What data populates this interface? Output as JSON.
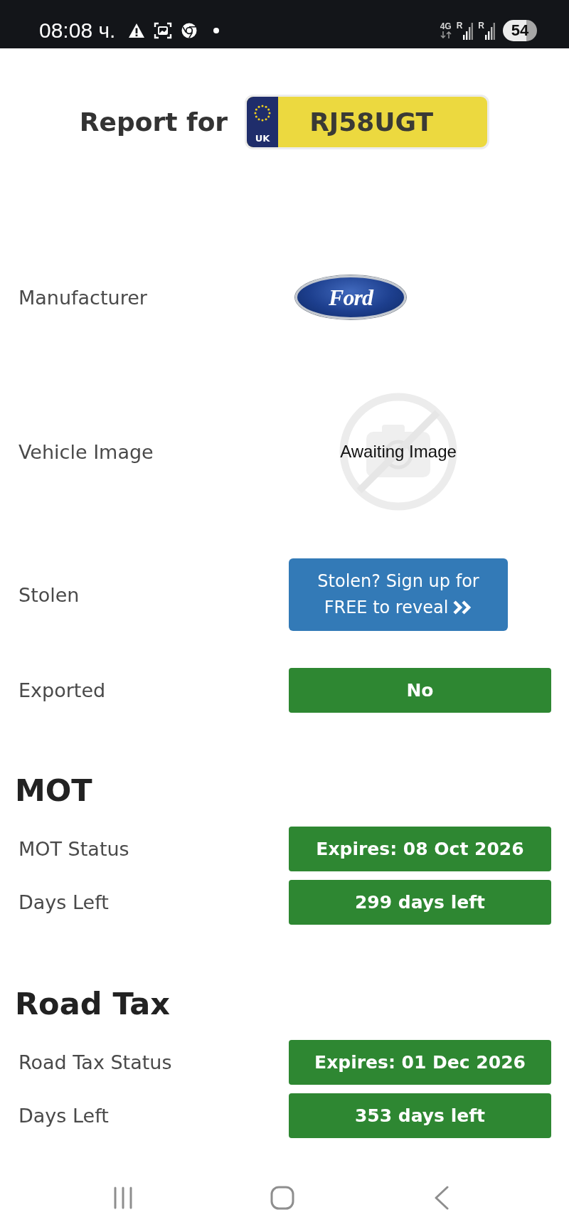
{
  "status_bar": {
    "time": "08:08 ч.",
    "network": "4G",
    "roaming": [
      "R",
      "R"
    ],
    "battery": "54"
  },
  "header": {
    "title": "Report for",
    "plate": {
      "country": "UK",
      "registration": "RJ58UGT"
    }
  },
  "details": [
    {
      "label": "Manufacturer",
      "kind": "logo",
      "value": "Ford"
    },
    {
      "label": "Vehicle Image",
      "kind": "image",
      "value": "Awaiting Image"
    },
    {
      "label": "Stolen",
      "kind": "link",
      "value": "Stolen? Sign up for FREE to reveal"
    },
    {
      "label": "Exported",
      "kind": "status",
      "value": "No"
    }
  ],
  "sections": [
    {
      "title": "MOT",
      "rows": [
        {
          "label": "MOT Status",
          "value": "Expires: 08 Oct 2026"
        },
        {
          "label": "Days Left",
          "value": "299 days left"
        }
      ]
    },
    {
      "title": "Road Tax",
      "rows": [
        {
          "label": "Road Tax Status",
          "value": "Expires: 01 Dec 2026"
        },
        {
          "label": "Days Left",
          "value": "353 days left"
        }
      ]
    }
  ]
}
